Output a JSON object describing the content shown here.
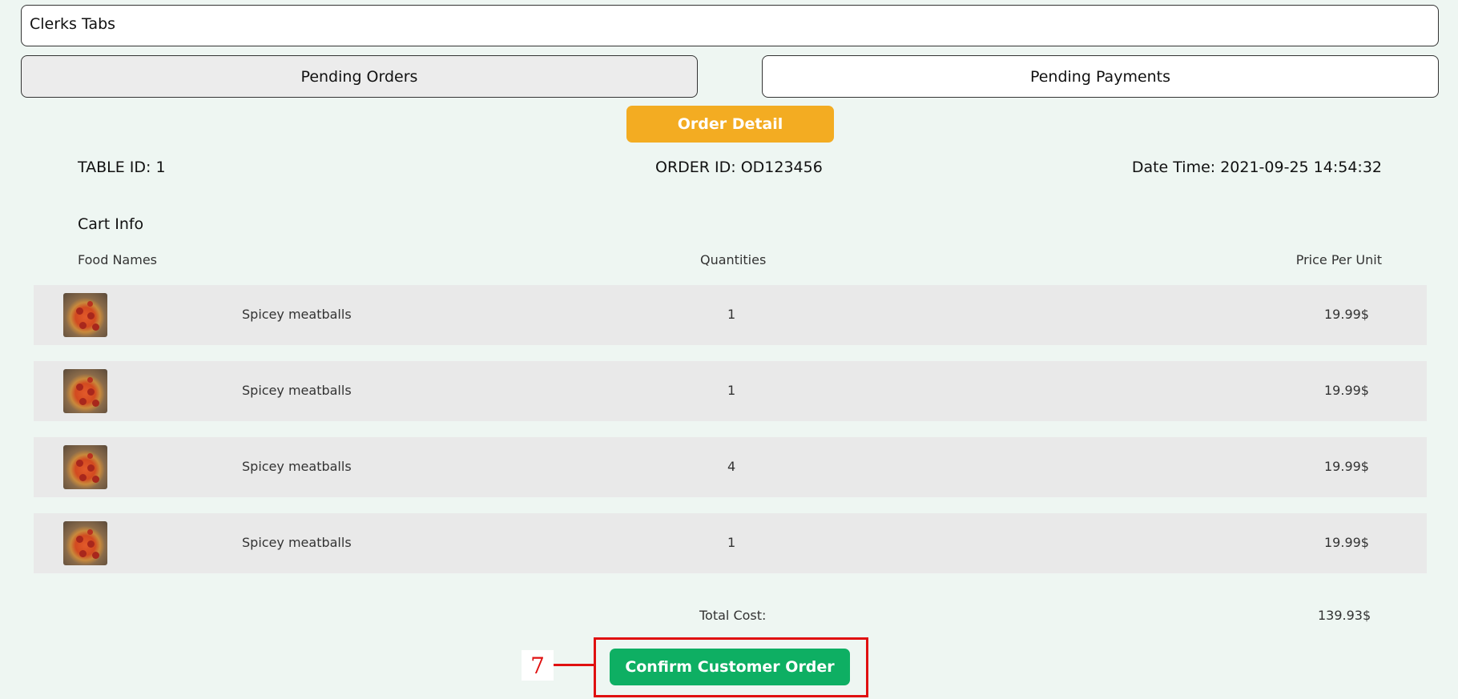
{
  "header": {
    "title": "Clerks Tabs"
  },
  "tabs": [
    {
      "label": "Pending Orders"
    },
    {
      "label": "Pending Payments"
    }
  ],
  "order_detail": {
    "button_label": "Order Detail",
    "table_id": "TABLE ID: 1",
    "order_id": "ORDER ID: OD123456",
    "date_time": "Date Time: 2021-09-25 14:54:32"
  },
  "cart": {
    "title": "Cart Info",
    "columns": {
      "food": "Food Names",
      "qty": "Quantities",
      "price": "Price Per Unit"
    },
    "items": [
      {
        "name": "Spicey meatballs",
        "qty": "1",
        "price": "19.99$",
        "image": "pizza-image"
      },
      {
        "name": "Spicey meatballs",
        "qty": "1",
        "price": "19.99$",
        "image": "pizza-image"
      },
      {
        "name": "Spicey meatballs",
        "qty": "4",
        "price": "19.99$",
        "image": "pizza-image"
      },
      {
        "name": "Spicey meatballs",
        "qty": "1",
        "price": "19.99$",
        "image": "pizza-image"
      }
    ],
    "total_label": "Total Cost:",
    "total_value": "139.93$"
  },
  "actions": {
    "confirm_label": "Confirm Customer Order"
  },
  "annotation": {
    "label": "7",
    "color": "#e01010"
  },
  "colors": {
    "background": "#eef6f2",
    "order_detail": "#f3ac22",
    "confirm": "#0eaf63"
  }
}
